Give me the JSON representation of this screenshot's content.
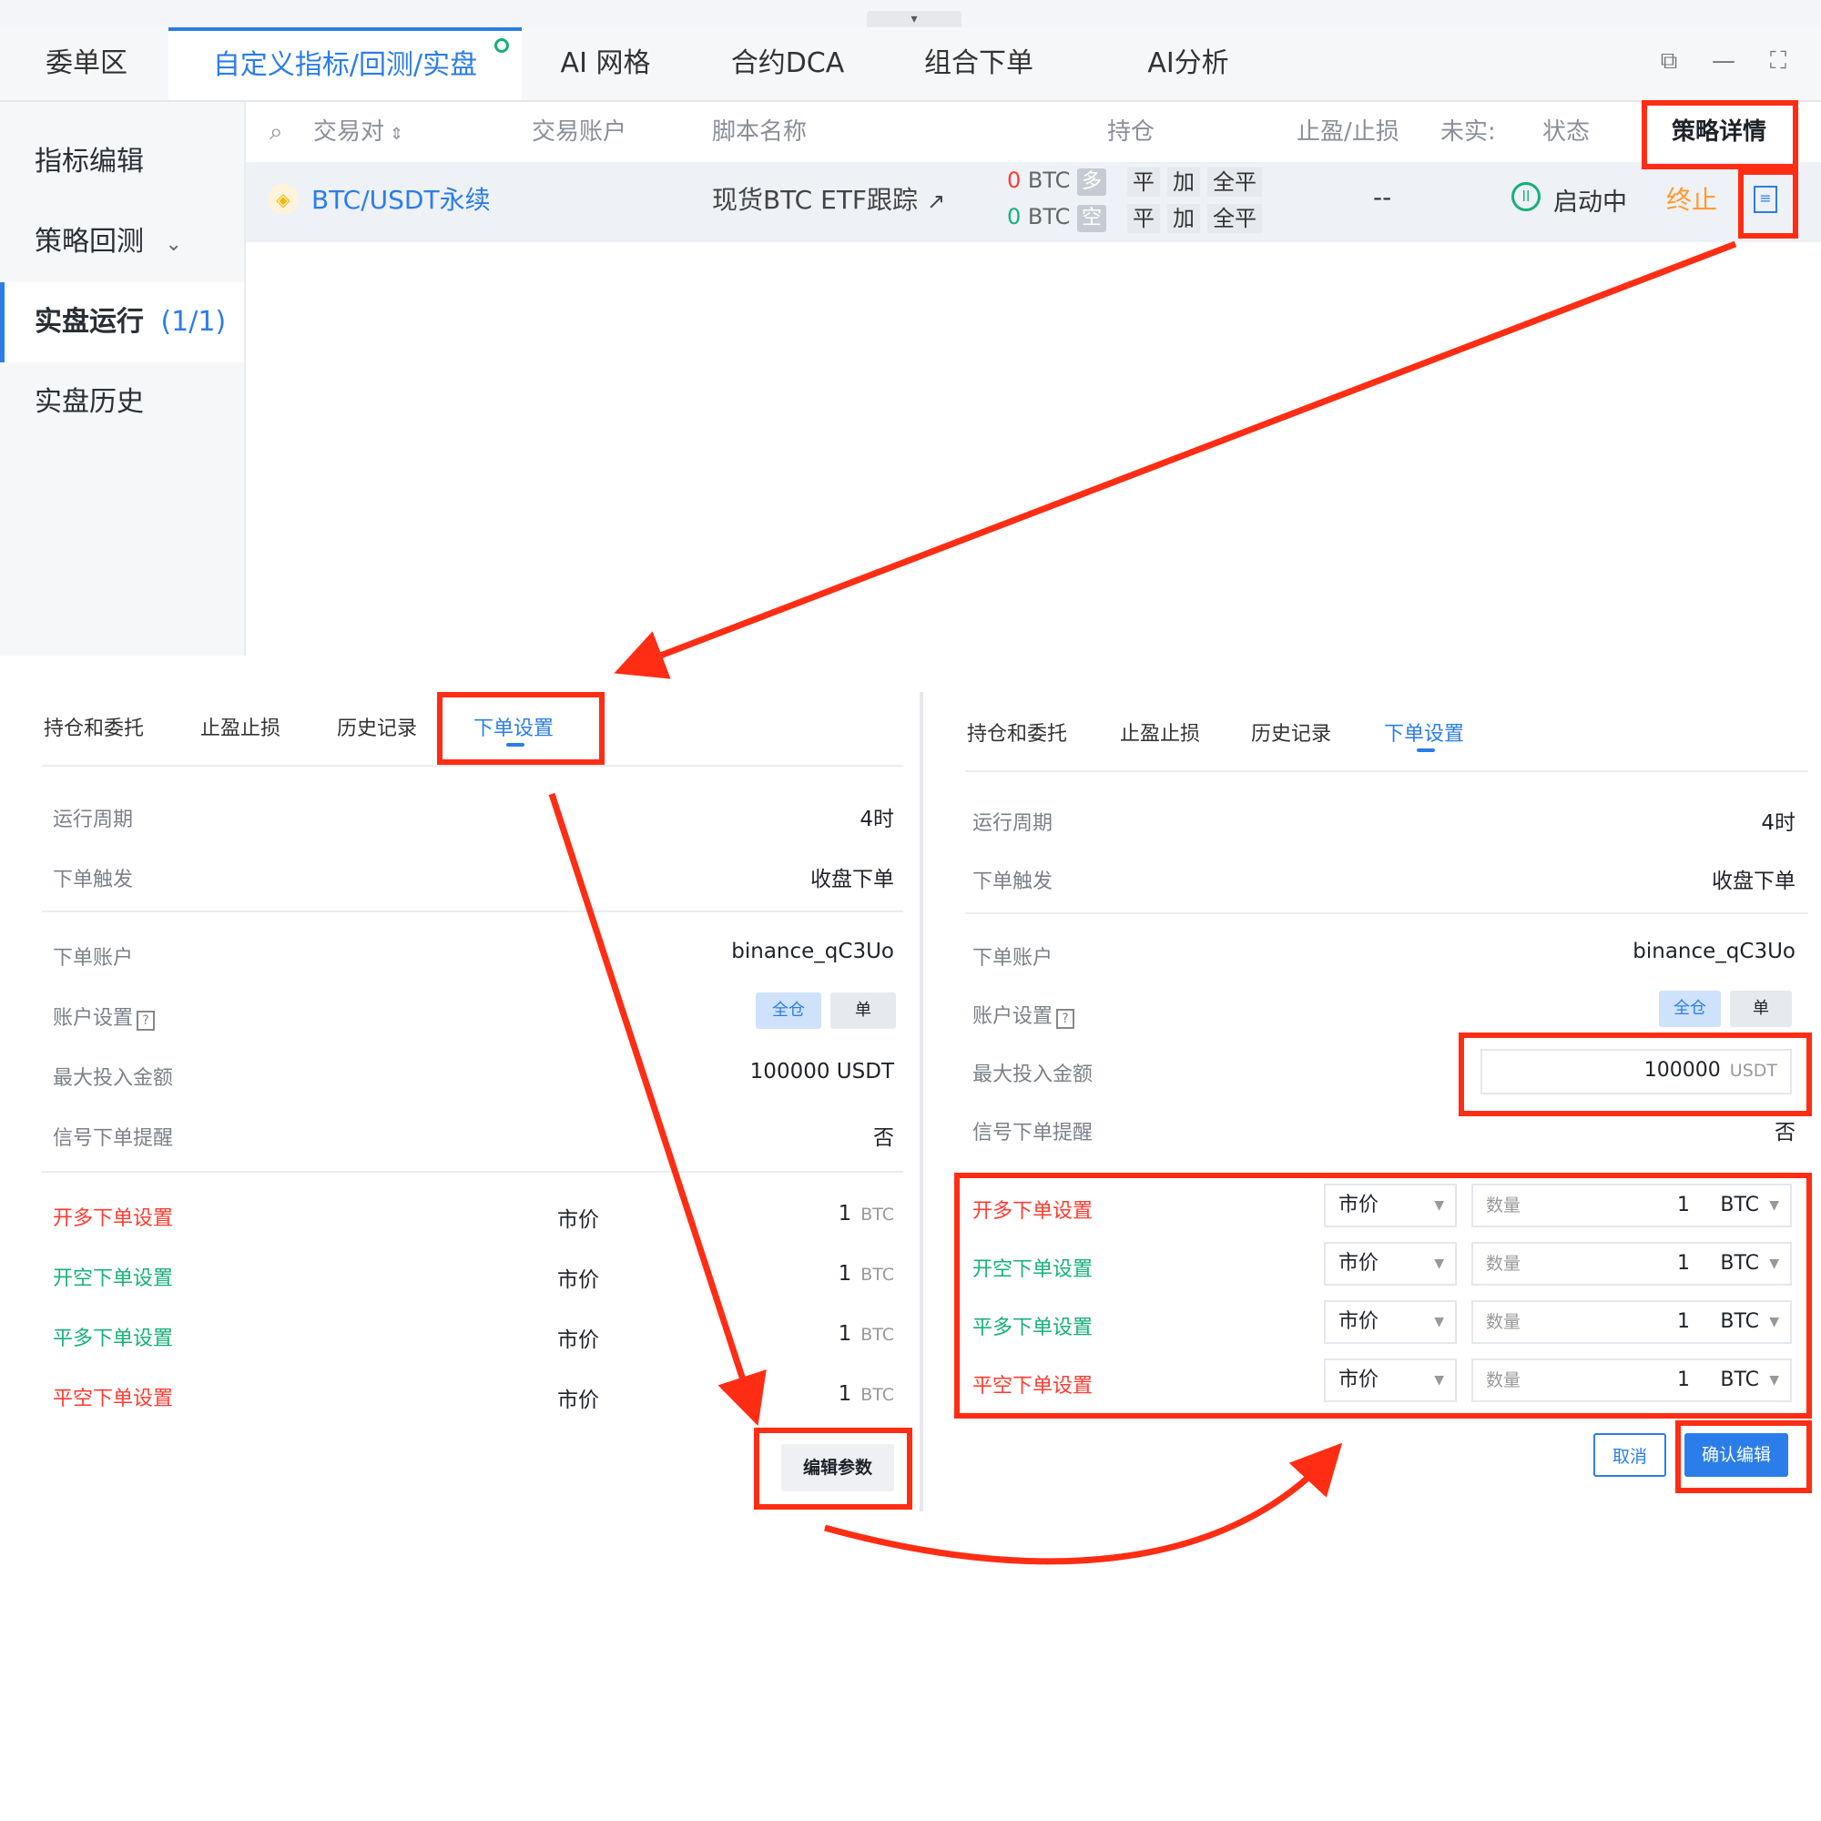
{
  "top": {
    "tabs": [
      "委单区",
      "自定义指标/回测/实盘",
      "AI 网格",
      "合约DCA",
      "组合下单",
      "AI分析"
    ],
    "sidebar": [
      "指标编辑",
      "策略回测",
      "实盘运行",
      "(1/1)",
      "实盘历史"
    ],
    "columns": [
      "交易对",
      "交易账户",
      "脚本名称",
      "持仓",
      "止盈/止损",
      "未实:",
      "状态",
      "策略详情"
    ],
    "row": {
      "pair": "BTC/USDT永续",
      "script": "现货BTC ETF跟踪",
      "pos_long_qty": "0",
      "pos_long_unit": "BTC",
      "pos_long_tag": "多",
      "pos_short_qty": "0",
      "pos_short_unit": "BTC",
      "pos_short_tag": "空",
      "ops": [
        "平",
        "加",
        "全平"
      ],
      "tpsl": "--",
      "status": "启动中",
      "stop": "终止"
    }
  },
  "panel": {
    "tabs": [
      "持仓和委托",
      "止盈止损",
      "历史记录",
      "下单设置"
    ],
    "labels": {
      "period": "运行周期",
      "trigger": "下单触发",
      "account": "下单账户",
      "account_settings": "账户设置",
      "max_amount": "最大投入金额",
      "signal_reminder": "信号下单提醒"
    },
    "values": {
      "period": "4时",
      "trigger": "收盘下单",
      "account": "binance_qC3Uo",
      "margin_full": "全仓",
      "margin_single": "单",
      "max_amount": "100000",
      "max_amount_unit": "USDT",
      "signal_reminder": "否"
    },
    "orders": [
      {
        "label": "开多下单设置",
        "type": "市价",
        "qty": "1",
        "unit": "BTC",
        "color": "#ff3b30"
      },
      {
        "label": "开空下单设置",
        "type": "市价",
        "qty": "1",
        "unit": "BTC",
        "color": "#16b079"
      },
      {
        "label": "平多下单设置",
        "type": "市价",
        "qty": "1",
        "unit": "BTC",
        "color": "#16b079"
      },
      {
        "label": "平空下单设置",
        "type": "市价",
        "qty": "1",
        "unit": "BTC",
        "color": "#ff3b30"
      }
    ],
    "qty_placeholder": "数量",
    "edit_button": "编辑参数",
    "cancel_button": "取消",
    "confirm_button": "确认编辑"
  },
  "colors": {
    "accent": "#2b7de9",
    "annotation": "#ff2d14",
    "long": "#ff3b30",
    "short": "#16b079",
    "stop": "#ff9a2e"
  }
}
